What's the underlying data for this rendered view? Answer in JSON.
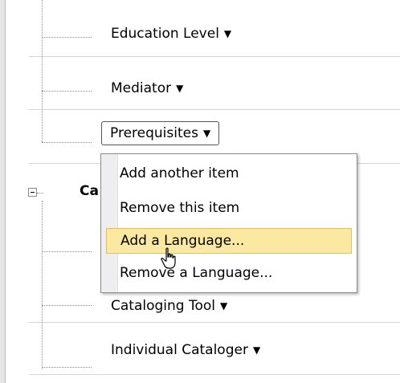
{
  "rows": [
    {
      "label": "Education Level"
    },
    {
      "label": "Mediator"
    },
    {
      "label": "Prerequisites"
    },
    {
      "label": "Ca"
    },
    {
      "label": "Cataloging Tool"
    },
    {
      "label": "Individual Cataloger"
    }
  ],
  "dropdown_caret": "▼",
  "context_menu": {
    "items": [
      {
        "label": "Add another item"
      },
      {
        "label": "Remove this item"
      },
      {
        "label": "Add a Language..."
      },
      {
        "label": "Remove a Language..."
      }
    ],
    "highlighted_item": "Add a Language..."
  },
  "colors": {
    "highlight_fill": "#fbe9a2",
    "highlight_border": "#e2c05c",
    "tree_lines": "#8c8c8c"
  }
}
